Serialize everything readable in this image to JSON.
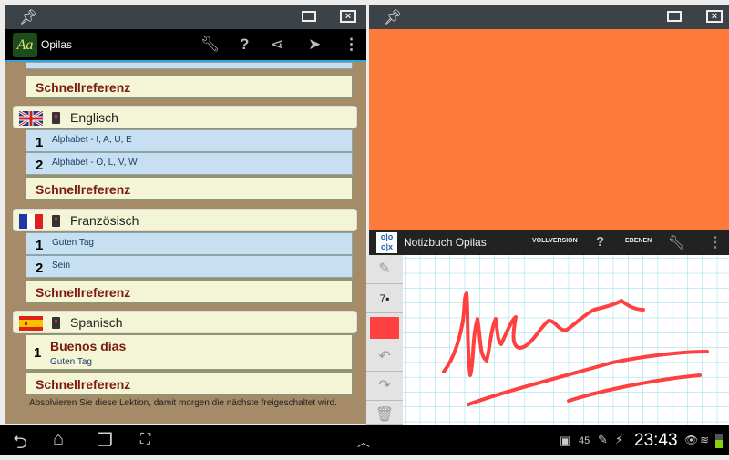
{
  "left_window": {
    "app_title": "Opilas",
    "logo_text": "Aa",
    "sections": [
      {
        "lang": "Englisch",
        "lessons": [
          {
            "num": "1",
            "title": "Alphabet - I, A, U, E"
          },
          {
            "num": "2",
            "title": "Alphabet - O, L, V, W"
          }
        ]
      },
      {
        "lang": "Französisch",
        "lessons": [
          {
            "num": "1",
            "title": "Guten Tag"
          },
          {
            "num": "2",
            "title": "Sein"
          }
        ]
      },
      {
        "lang": "Spanisch",
        "lessons": [
          {
            "num": "1",
            "title": "Buenos días",
            "subtitle": "Guten Tag"
          }
        ]
      }
    ],
    "quickref": "Schnellreferenz",
    "footer": "Absolvieren Sie diese Lektion, damit morgen die nächste freigeschaltet wird."
  },
  "right_window": {
    "app_title": "Notizbuch Opilas",
    "full_version": "VOLLVERSION",
    "help": "?",
    "layers": "EBENEN",
    "brush_size": "7",
    "ink_color": "#ff4040",
    "top_color": "#fd7a3a"
  },
  "status": {
    "notif_count": "45",
    "time": "23:43"
  }
}
